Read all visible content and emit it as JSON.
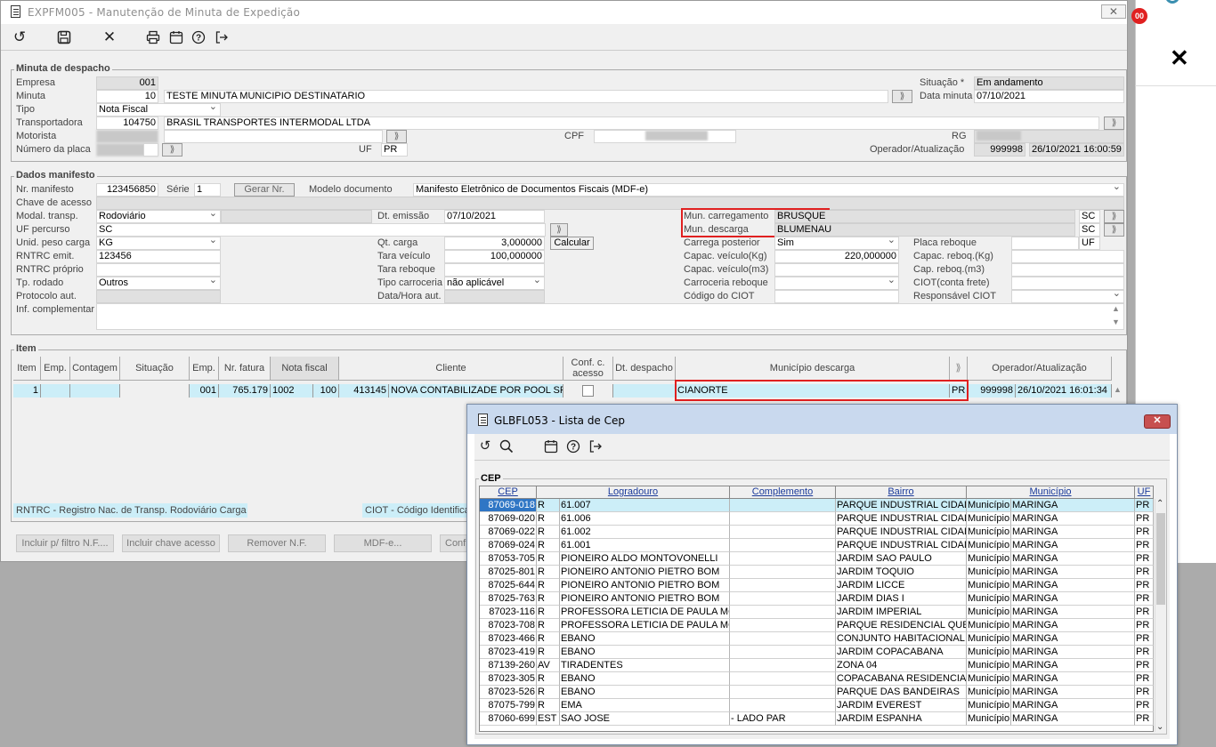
{
  "main_window": {
    "title": "EXPFM005 - Manutenção de Minuta de Expedição",
    "close": "✕"
  },
  "toolbar": {
    "icons": [
      "undo-icon",
      "save-icon",
      "cancel-icon",
      "print-icon",
      "calendar-icon",
      "help-icon",
      "exit-icon"
    ]
  },
  "minuta": {
    "title": "Minuta de despacho",
    "empresa_label": "Empresa",
    "empresa": "001",
    "minuta_label": "Minuta",
    "minuta": "10",
    "minuta_desc": "TESTE MINUTA MUNICIPIO DESTINATARIO",
    "tipo_label": "Tipo",
    "tipo": "Nota Fiscal",
    "transportadora_label": "Transportadora",
    "transportadora_cod": "104750",
    "transportadora": "BRASIL TRANSPORTES INTERMODAL LTDA",
    "motorista_label": "Motorista",
    "placa_label": "Número da placa",
    "uf_label": "UF",
    "uf": "PR",
    "cpf_label": "CPF",
    "rg_label": "RG",
    "situacao_label": "Situação *",
    "situacao": "Em andamento",
    "data_label": "Data minuta",
    "data": "07/10/2021",
    "operador_label": "Operador/Atualização",
    "operador": "999998",
    "operador_data": "26/10/2021 16:00:59"
  },
  "manifesto": {
    "title": "Dados manifesto",
    "nr_label": "Nr. manifesto",
    "nr": "123456850",
    "serie_label": "Série",
    "serie": "1",
    "gerar": "Gerar Nr.",
    "modelo_label": "Modelo documento",
    "modelo": "Manifesto Eletrônico de Documentos Fiscais (MDF-e)",
    "chave_label": "Chave de acesso",
    "modal_label": "Modal. transp.",
    "modal": "Rodoviário",
    "emissao_label": "Dt. emissão",
    "emissao": "07/10/2021",
    "ufperc_label": "UF percurso",
    "ufperc": "SC",
    "unid_label": "Unid. peso carga",
    "unid": "KG",
    "rntrc_emit_label": "RNTRC emit.",
    "rntrc_emit": "123456",
    "rntrc_proprio_label": "RNTRC próprio",
    "rodado_label": "Tp. rodado",
    "rodado": "Outros",
    "protocolo_label": "Protocolo aut.",
    "inf_label": "Inf. complementar",
    "qtcarga_label": "Qt. carga",
    "qtcarga": "3,000000",
    "taraveic_label": "Tara veículo",
    "taraveic": "100,000000",
    "tararebo_label": "Tara reboque",
    "tipocarr_label": "Tipo carroceria",
    "tipocarr": "não aplicável",
    "datahora_label": "Data/Hora aut.",
    "calcular": "Calcular",
    "muncarreg_label": "Mun. carregamento",
    "muncarreg": "BRUSQUE",
    "muncarreg_uf": "SC",
    "mundesc_label": "Mun. descarga",
    "mundesc": "BLUMENAU",
    "mundesc_uf": "SC",
    "carregapost_label": "Carrega posterior",
    "carregapost": "Sim",
    "capkg_label": "Capac. veículo(Kg)",
    "capkg": "220,000000",
    "capm3_label": "Capac. veículo(m3)",
    "carrreb_label": "Carroceria reboque",
    "ciot_label": "Código do CIOT",
    "placareb_label": "Placa reboque",
    "placareb_uf": "UF",
    "caprebkg_label": "Capac. reboq.(Kg)",
    "caprebm3_label": "Cap. reboq.(m3)",
    "ciotfrete_label": "CIOT(conta frete)",
    "respciot_label": "Responsável CIOT"
  },
  "item": {
    "title": "Item",
    "headers": [
      "Item",
      "Emp.",
      "Contagem",
      "Situação",
      "Emp.",
      "Nr. fatura",
      "Nota fiscal",
      "Cliente",
      "Conf. c. acesso",
      "Dt. despacho",
      "Município descarga",
      "Operador/Atualização"
    ],
    "row": {
      "item": "1",
      "emp2": "001",
      "fatura": "765.179",
      "nf": "1002",
      "nf2": "100",
      "cli_cod": "413145",
      "cliente": "NOVA CONTABILIZADE POR POOL SPED",
      "municipio": "CIANORTE",
      "uf": "PR",
      "op": "999998",
      "op_data": "26/10/2021 16:01:34"
    },
    "legend_rntrc": "RNTRC - Registro Nac. de Transp. Rodoviário Carga",
    "legend_ciot": "CIOT - Código Identificador"
  },
  "bottom_buttons": [
    "Incluir p/ filtro N.F....",
    "Incluir chave acesso",
    "Remover N.F.",
    "MDF-e...",
    "Conf"
  ],
  "cep_window": {
    "title": "GLBFL053 - Lista de Cep",
    "close": "✕",
    "group": "CEP",
    "headers": [
      "CEP",
      "Logradouro",
      "Complemento",
      "Bairro",
      "Município",
      "UF"
    ],
    "rows": [
      [
        "87069-018",
        "R",
        "61.007",
        "",
        "PARQUE INDUSTRIAL CIDADE",
        "Município",
        "MARINGA",
        "PR"
      ],
      [
        "87069-020",
        "R",
        "61.006",
        "",
        "PARQUE INDUSTRIAL CIDADE",
        "Município",
        "MARINGA",
        "PR"
      ],
      [
        "87069-022",
        "R",
        "61.002",
        "",
        "PARQUE INDUSTRIAL CIDADE",
        "Município",
        "MARINGA",
        "PR"
      ],
      [
        "87069-024",
        "R",
        "61.001",
        "",
        "PARQUE INDUSTRIAL CIDADE",
        "Município",
        "MARINGA",
        "PR"
      ],
      [
        "87053-705",
        "R",
        "PIONEIRO ALDO MONTOVONELLI",
        "",
        "JARDIM SAO PAULO",
        "Município",
        "MARINGA",
        "PR"
      ],
      [
        "87025-801",
        "R",
        "PIONEIRO ANTONIO PIETRO BOM",
        "",
        "JARDIM TOQUIO",
        "Município",
        "MARINGA",
        "PR"
      ],
      [
        "87025-644",
        "R",
        "PIONEIRO ANTONIO PIETRO BOM",
        "",
        "JARDIM LICCE",
        "Município",
        "MARINGA",
        "PR"
      ],
      [
        "87025-763",
        "R",
        "PIONEIRO ANTONIO PIETRO BOM",
        "",
        "JARDIM DIAS I",
        "Município",
        "MARINGA",
        "PR"
      ],
      [
        "87023-116",
        "R",
        "PROFESSORA LETICIA DE PAULA MOL",
        "",
        "JARDIM IMPERIAL",
        "Município",
        "MARINGA",
        "PR"
      ],
      [
        "87023-708",
        "R",
        "PROFESSORA LETICIA DE PAULA MOL",
        "",
        "PARQUE RESIDENCIAL QUEBE",
        "Município",
        "MARINGA",
        "PR"
      ],
      [
        "87023-466",
        "R",
        "EBANO",
        "",
        "CONJUNTO HABITACIONAL H",
        "Município",
        "MARINGA",
        "PR"
      ],
      [
        "87023-419",
        "R",
        "EBANO",
        "",
        "JARDIM COPACABANA",
        "Município",
        "MARINGA",
        "PR"
      ],
      [
        "87139-260",
        "AV",
        "TIRADENTES",
        "",
        "ZONA 04",
        "Município",
        "MARINGA",
        "PR"
      ],
      [
        "87023-305",
        "R",
        "EBANO",
        "",
        "COPACABANA RESIDENCIAL",
        "Município",
        "MARINGA",
        "PR"
      ],
      [
        "87023-526",
        "R",
        "EBANO",
        "",
        "PARQUE DAS BANDEIRAS",
        "Município",
        "MARINGA",
        "PR"
      ],
      [
        "87075-799",
        "R",
        "EMA",
        "",
        "JARDIM EVEREST",
        "Município",
        "MARINGA",
        "PR"
      ],
      [
        "87060-699",
        "EST",
        "SAO JOSE",
        "- LADO PAR",
        "JARDIM ESPANHA",
        "Município",
        "MARINGA",
        "PR"
      ]
    ]
  },
  "side": {
    "badge": "00",
    "close": "✕"
  }
}
